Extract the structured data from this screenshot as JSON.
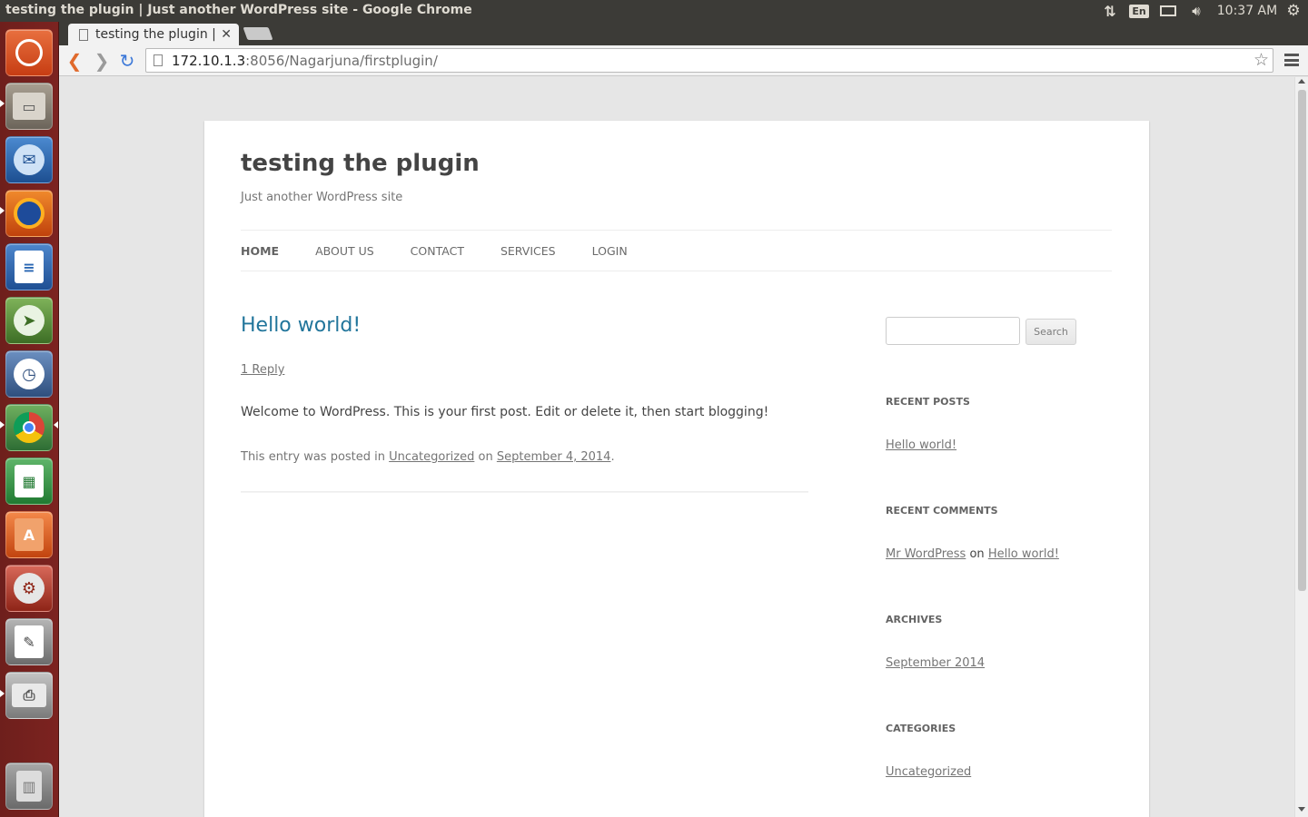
{
  "desktop": {
    "window_title": "testing the plugin | Just another WordPress site - Google Chrome",
    "keyboard_layout": "En",
    "clock": "10:37 AM",
    "launcher_items": [
      {
        "name": "dash-home",
        "icon": "ubuntu-logo-icon",
        "color": "#dd4814"
      },
      {
        "name": "files",
        "icon": "file-cabinet-icon",
        "color": "#8c8273"
      },
      {
        "name": "thunderbird",
        "icon": "thunderbird-icon",
        "color": "#2d6db5"
      },
      {
        "name": "firefox",
        "icon": "firefox-icon",
        "color": "#e66000"
      },
      {
        "name": "libreoffice-writer",
        "icon": "writer-document-icon",
        "color": "#2a67b3"
      },
      {
        "name": "system-tool",
        "icon": "compass-gear-icon",
        "color": "#5a8f3a"
      },
      {
        "name": "clock-app",
        "icon": "clock-icon",
        "color": "#4a6d9e"
      },
      {
        "name": "chrome",
        "icon": "chrome-icon",
        "color": "#3b8a3f"
      },
      {
        "name": "libreoffice-calc",
        "icon": "calc-spreadsheet-icon",
        "color": "#2d8a3b"
      },
      {
        "name": "software-center",
        "icon": "shopping-bag-icon",
        "color": "#e05b1e"
      },
      {
        "name": "system-settings",
        "icon": "wrench-gear-icon",
        "color": "#b23b2c"
      },
      {
        "name": "text-editor",
        "icon": "text-editor-icon",
        "color": "#7d7d7d"
      },
      {
        "name": "scanner",
        "icon": "scanner-icon",
        "color": "#8a8a8a"
      },
      {
        "name": "trash",
        "icon": "trash-icon",
        "color": "#9b9b9b"
      }
    ]
  },
  "browser": {
    "tab_title": "testing the plugin | Ju",
    "url_host": "172.10.1.3",
    "url_path": ":8056/Nagarjuna/firstplugin/"
  },
  "site": {
    "title": "testing the plugin",
    "description": "Just another WordPress site",
    "nav": [
      "HOME",
      "ABOUT US",
      "CONTACT",
      "SERVICES",
      "LOGIN"
    ],
    "post": {
      "title": "Hello world!",
      "reply": "1 Reply",
      "body": "Welcome to WordPress. This is your first post. Edit or delete it, then start blogging!",
      "meta_prefix": "This entry was posted in",
      "category": "Uncategorized",
      "meta_on": "on",
      "date": "September 4, 2014",
      "meta_suffix": "."
    },
    "sidebar": {
      "search_button": "Search",
      "recent_posts_title": "RECENT POSTS",
      "recent_post": "Hello world!",
      "recent_comments_title": "RECENT COMMENTS",
      "comment_author": "Mr WordPress",
      "comment_on": "on",
      "comment_post": "Hello world!",
      "archives_title": "ARCHIVES",
      "archive": "September 2014",
      "categories_title": "CATEGORIES",
      "category": "Uncategorized"
    }
  }
}
